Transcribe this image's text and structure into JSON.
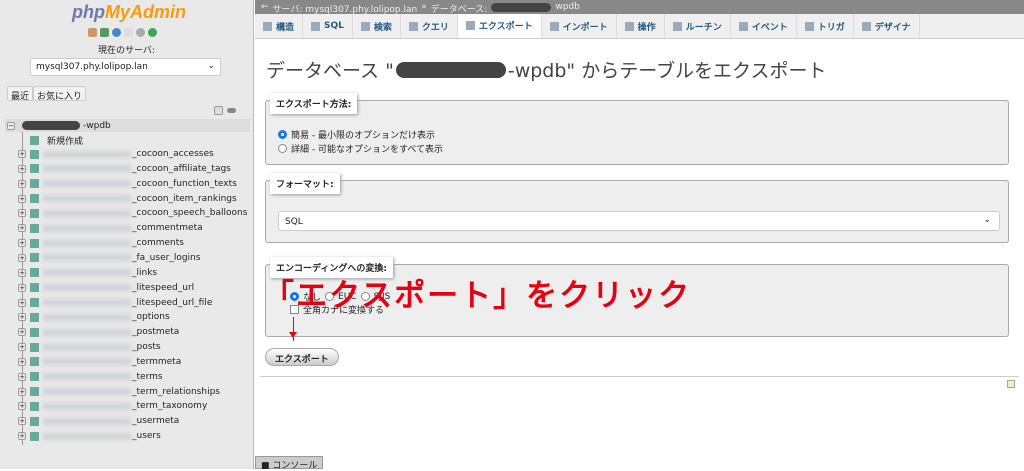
{
  "sidebar": {
    "logo_php": "php",
    "logo_my": "MyAdmin",
    "server_label": "現在のサーバ:",
    "server": "mysql307.phy.lolipop.lan",
    "recent": "最近",
    "favorites": "お気に入り",
    "db_suffix": "-wpdb",
    "new": "新規作成",
    "tables": [
      "_cocoon_accesses",
      "_cocoon_affiliate_tags",
      "_cocoon_function_texts",
      "_cocoon_item_rankings",
      "_cocoon_speech_balloons",
      "_commentmeta",
      "_comments",
      "_fa_user_logins",
      "_links",
      "_litespeed_url",
      "_litespeed_url_file",
      "_options",
      "_postmeta",
      "_posts",
      "_termmeta",
      "_terms",
      "_term_relationships",
      "_term_taxonomy",
      "_usermeta",
      "_users"
    ]
  },
  "breadcrumb": {
    "server": "サーバ: mysql307.phy.lolipop.lan",
    "sep": "»",
    "db": "データベース:",
    "db_suffix": "wpdb"
  },
  "tabs": [
    "構造",
    "SQL",
    "検索",
    "クエリ",
    "エクスポート",
    "インポート",
    "操作",
    "ルーチン",
    "イベント",
    "トリガ",
    "デザイナ"
  ],
  "title": {
    "pre": "データベース \"",
    "post": "-wpdb\" からテーブルをエクスポート"
  },
  "method": {
    "legend": "エクスポート方法:",
    "quick": "簡易 - 最小限のオプションだけ表示",
    "custom": "詳細 - 可能なオプションをすべて表示"
  },
  "format": {
    "legend": "フォーマット:",
    "value": "SQL"
  },
  "encoding": {
    "legend": "エンコーディングへの変換:",
    "none": "なし",
    "euc": "EUC",
    "sjis": "SJIS",
    "kana": "全角カナに変換する"
  },
  "export_button": "エクスポート",
  "annotation": "「エクスポート」をクリック",
  "console": "コンソール",
  "colors": {
    "accent": "#e60012",
    "link": "#235a81"
  }
}
